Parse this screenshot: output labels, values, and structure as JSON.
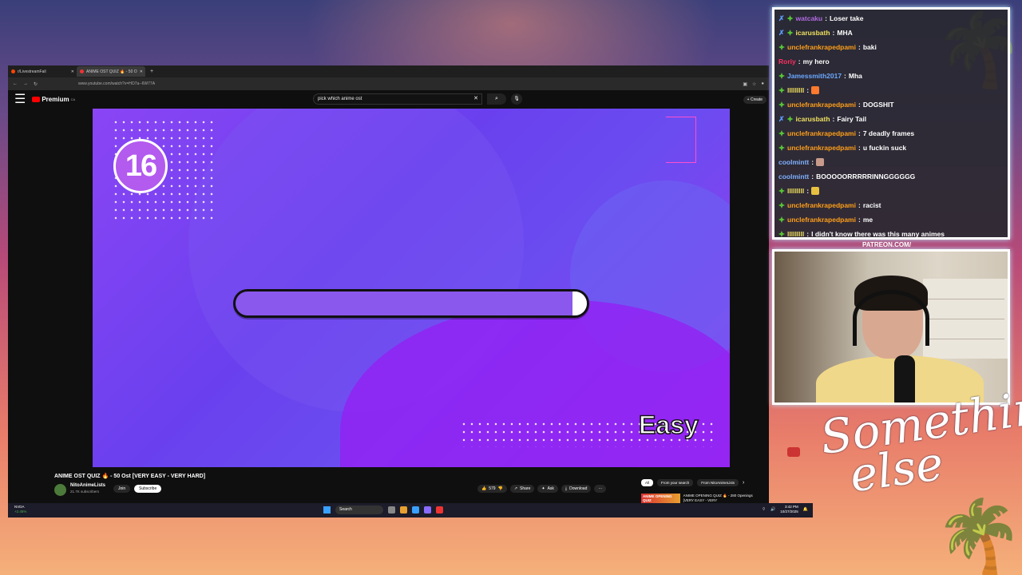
{
  "browser": {
    "tabs": [
      {
        "label": "r/LivestreamFail"
      },
      {
        "label": "ANIME OST QUIZ 🔥 - 50 O"
      }
    ],
    "url": "www.youtube.com/watch?v=HO7a--6W77A"
  },
  "youtube": {
    "logo": "Premium",
    "logo_sup": "CA",
    "search_value": "pick which anime ost",
    "create_label": "+ Create"
  },
  "video": {
    "question_number": "16",
    "difficulty_label": "Easy",
    "timer_remaining_fraction": 0.04
  },
  "video_info": {
    "title": "ANIME OST QUIZ 🔥 - 50 Ost [VERY EASY - VERY HARD]",
    "channel": "NitoAnimeLists",
    "subscribers": "21.7K subscribers",
    "join": "Join",
    "subscribe": "Subscribe",
    "likes": "579",
    "share": "Share",
    "ask": "Ask",
    "download": "Download",
    "more": "···"
  },
  "chips": [
    "All",
    "From your search",
    "From NitoAnimeLists"
  ],
  "recommendation": {
    "thumb_text": "ANIME OPENING QUIZ",
    "title": "ANIME OPENING QUIZ 🔥 - 280 Openings [VERY EASY - VERY"
  },
  "taskbar": {
    "stock_name": "NVDA",
    "stock_change": "+2.45%",
    "search_placeholder": "Search",
    "time": "3:42 PM",
    "date": "10/27/2025"
  },
  "chat": [
    {
      "user": "watcaku",
      "text": "Loser take",
      "badge": "blue",
      "color": "#b06be0"
    },
    {
      "user": "icarusbath",
      "text": "MHA",
      "badge": "blue",
      "color": "#f0e060"
    },
    {
      "user": "unclefrankrapedpami",
      "text": "baki",
      "badge": "green",
      "color": "#ff9f1a"
    },
    {
      "user": "Roriy",
      "text": "my hero",
      "badge": "",
      "color": "#ff3060"
    },
    {
      "user": "Jamessmith2017",
      "text": "Mha",
      "badge": "green",
      "color": "#6aa8ff"
    },
    {
      "user": "lllllllll",
      "text": "",
      "badge": "green",
      "color": "#f0e060",
      "emote": "#ff7a2e"
    },
    {
      "user": "unclefrankrapedpami",
      "text": "DOGSHIT",
      "badge": "green",
      "color": "#ff9f1a"
    },
    {
      "user": "icarusbath",
      "text": "Fairy Tail",
      "badge": "blue",
      "color": "#f0e060"
    },
    {
      "user": "unclefrankrapedpami",
      "text": "7 deadly frames",
      "badge": "green",
      "color": "#ff9f1a"
    },
    {
      "user": "unclefrankrapedpami",
      "text": "u fuckin suck",
      "badge": "green",
      "color": "#ff9f1a"
    },
    {
      "user": "coolmintt",
      "text": "",
      "badge": "",
      "color": "#7fb0ff",
      "emote": "#c89a8a"
    },
    {
      "user": "coolmintt",
      "text": "BOOOOORRRRRINNGGGGGG",
      "badge": "",
      "color": "#7fb0ff"
    },
    {
      "user": "lllllllll",
      "text": "",
      "badge": "green",
      "color": "#f0e060",
      "emote": "#e8c040"
    },
    {
      "user": "unclefrankrapedpami",
      "text": "racist",
      "badge": "green",
      "color": "#ff9f1a"
    },
    {
      "user": "unclefrankrapedpami",
      "text": "me",
      "badge": "green",
      "color": "#ff9f1a"
    },
    {
      "user": "lllllllll",
      "text": "I didn't know there was this many animes",
      "badge": "green",
      "color": "#f0e060"
    }
  ],
  "overlay": {
    "patreon": "PATREON.COM/",
    "logo_line1": "Something",
    "logo_line2": "else"
  }
}
